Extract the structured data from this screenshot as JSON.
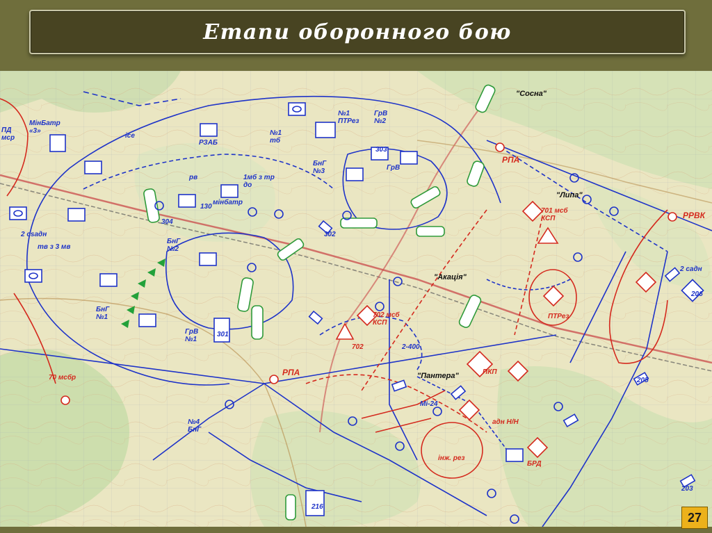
{
  "slide": {
    "title": "Етапи оборонного бою",
    "page_number": "27"
  },
  "colors": {
    "frame": "#6f6e3c",
    "title_bg": "#484422",
    "map_base": "#eae6c2",
    "friendly": "#1e33c8",
    "enemy": "#d42a1e",
    "engineer": "#2f9a3a",
    "page_badge": "#ecb11b"
  },
  "map": {
    "blue_labels": {
      "pd_misr": "ПД\nмср",
      "minbatr3": "МінБатр\n«3»",
      "ise": "ісе",
      "rzab": "РЗАБ",
      "tb1": "№1\nтб",
      "ptrez1": "№1\nПТРез",
      "grv2": "ГрВ\n№2",
      "bng3": "БнГ\n№3",
      "mb1_do": "1мб з тр\nдо",
      "pv": "рв",
      "minbatr": "мінбатр",
      "n130": "130",
      "n304": "304",
      "sadn2": "2 сsадн",
      "te3mb": "тв з 3 мв",
      "bng2": "БнГ\n№2",
      "bng1": "БнГ\n№1",
      "grv1": "ГрВ\n№1",
      "n303": "303",
      "grv": "ГрВ",
      "n302": "302",
      "n301": "301",
      "bng4": "№4\nБнГ",
      "n216": "216",
      "sadn2b": "2 садн",
      "n206": "206",
      "n205": "205",
      "n203": "203",
      "mi24": "Мі-24",
      "n2_400": "2-400"
    },
    "red_labels": {
      "mbr70": "70 мсбр",
      "rpa1": "РПА",
      "rpa2": "РПА",
      "msb701": "701 мсб\nКСП",
      "msb702": "702 мсб\nКСП",
      "n702": "702",
      "ptrez": "ПТРез",
      "rrvk": "РРВК",
      "pkp": "ПКП",
      "adn": "адн Н/Н",
      "inzh": "інж. рез",
      "brd": "БРД"
    },
    "place_names": {
      "sosna": "\"Сосна\"",
      "lypa": "\"Липа\"",
      "akatsiia": "\"Акація\"",
      "pantera": "\"Пантера\""
    }
  }
}
